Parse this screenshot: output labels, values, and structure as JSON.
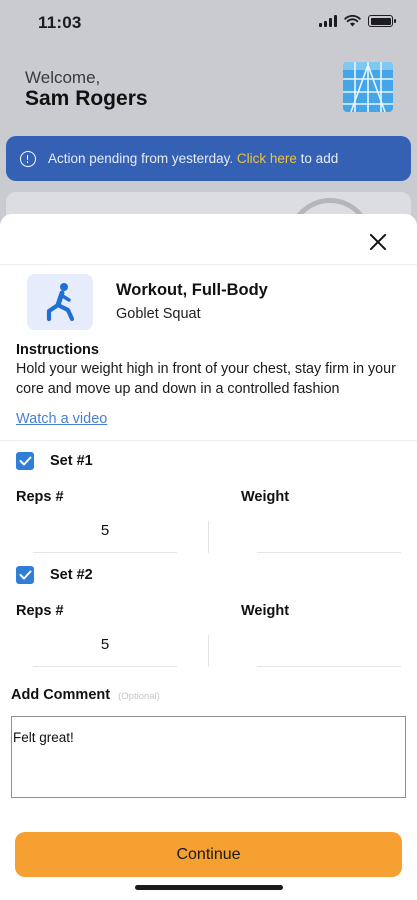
{
  "status_bar": {
    "time": "11:03"
  },
  "header": {
    "welcome": "Welcome,",
    "user_name": "Sam Rogers"
  },
  "banner": {
    "text": "Action pending from yesterday.",
    "link": "Click here",
    "suffix": "to add"
  },
  "exercise": {
    "title": "Workout, Full-Body",
    "name": "Goblet Squat",
    "instructions_heading": "Instructions",
    "instructions": "Hold your weight high in front of your chest, stay firm in your core and move up and down in a controlled fashion",
    "video_link": "Watch a video",
    "icon": "person-lunge-icon"
  },
  "sets": [
    {
      "label": "Set #1",
      "checked": true,
      "reps_label": "Reps #",
      "weight_label": "Weight",
      "reps": "5",
      "weight": ""
    },
    {
      "label": "Set #2",
      "checked": true,
      "reps_label": "Reps #",
      "weight_label": "Weight",
      "reps": "5",
      "weight": ""
    }
  ],
  "comment": {
    "label": "Add Comment",
    "optional": "(Optional)",
    "value": "Felt great!"
  },
  "continue_label": "Continue",
  "colors": {
    "banner": "#3561b4",
    "link_yellow": "#f0c33a",
    "checkbox": "#2f7fd8",
    "button": "#f5a030",
    "video_link": "#4a7fd0"
  }
}
